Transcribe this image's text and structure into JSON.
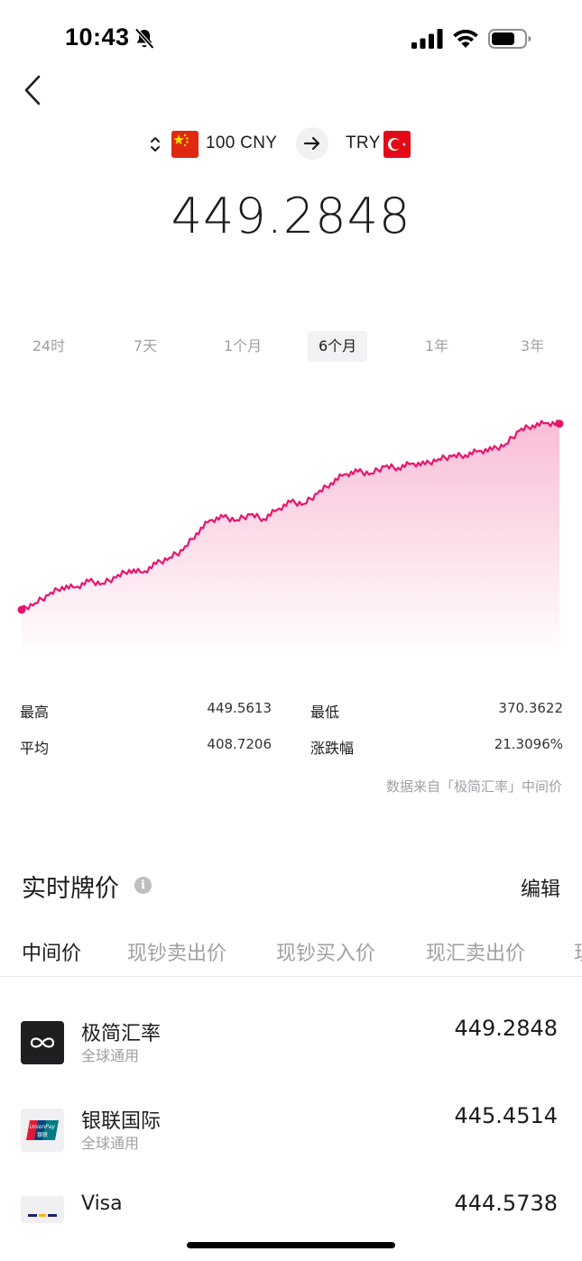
{
  "status_bar": {
    "time": "10:43"
  },
  "converter": {
    "from_label": "100 CNY",
    "to_label": "TRY",
    "rate": "449.2848"
  },
  "range_tabs": [
    {
      "label": "24时"
    },
    {
      "label": "7天"
    },
    {
      "label": "1个月"
    },
    {
      "label": "6个月",
      "active": true
    },
    {
      "label": "1年"
    },
    {
      "label": "3年"
    }
  ],
  "chart_data": {
    "type": "area",
    "color": "#e8156e",
    "values": [
      370.36,
      373.2,
      376.5,
      380.1,
      379.8,
      382.4,
      381.5,
      384.0,
      387.3,
      386.1,
      389.8,
      392.5,
      395.6,
      402.8,
      408.3,
      409.6,
      408.4,
      410.7,
      408.9,
      412.8,
      416.0,
      415.3,
      419.6,
      424.1,
      427.8,
      428.9,
      428.2,
      431.1,
      430.6,
      432.4,
      432.0,
      434.3,
      435.4,
      436.0,
      437.7,
      438.2,
      440.6,
      446.2,
      448.6,
      449.56,
      449.28
    ],
    "start_value": 370.3622,
    "end_value": 449.2848
  },
  "stats": {
    "high_label": "最高",
    "high_value": "449.5613",
    "low_label": "最低",
    "low_value": "370.3622",
    "avg_label": "平均",
    "avg_value": "408.7206",
    "change_label": "涨跌幅",
    "change_value": "21.3096%"
  },
  "source_note": "数据来自「极简汇率」中间价",
  "section": {
    "title": "实时牌价",
    "info_glyph": "i",
    "edit_label": "编辑"
  },
  "price_tabs": [
    {
      "label": "中间价",
      "active": true
    },
    {
      "label": "现钞卖出价"
    },
    {
      "label": "现钞买入价"
    },
    {
      "label": "现汇卖出价"
    },
    {
      "label": "现"
    }
  ],
  "rows": [
    {
      "name": "极简汇率",
      "sub": "全球通用",
      "value": "449.2848",
      "icon": "infinity-logo-icon"
    },
    {
      "name": "银联国际",
      "sub": "全球通用",
      "value": "445.4514",
      "icon": "unionpay-logo-icon"
    },
    {
      "name": "Visa",
      "sub": "",
      "value": "444.5738",
      "icon": "visa-logo-icon"
    }
  ],
  "logos": {
    "unionpay_top": "UnionPay",
    "unionpay_bottom": "银联"
  }
}
